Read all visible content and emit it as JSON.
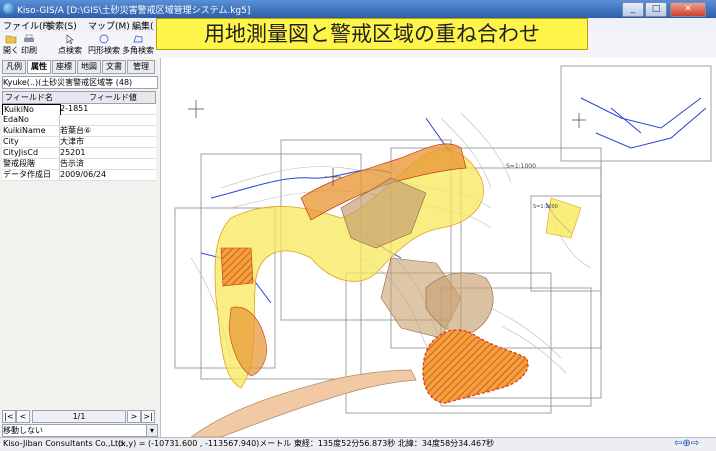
{
  "window": {
    "title": "Kiso-GIS/A [D:\\GIS\\土砂災害警戒区域管理システム.kg5]",
    "minimize": "_",
    "maximize": "□",
    "close": "✕"
  },
  "menu": [
    "ファイル(F)",
    "検索(S)",
    "マップ(M)",
    "編集("
  ],
  "toolbar": {
    "tools": [
      "開く",
      "印刷",
      "点検索",
      "円形検索",
      "多角検索"
    ]
  },
  "banner": {
    "text": "用地測量図と警戒区域の重ね合わせ"
  },
  "left_panel": {
    "tabs": [
      "凡例",
      "属性",
      "座標",
      "地図",
      "文書",
      "管理"
    ],
    "active_tab": "属性",
    "layer": "Kyuke(..)(土砂災害警戒区域等 (48)",
    "columns": {
      "field": "フィールド名",
      "value": "フィールド値"
    },
    "rows": [
      {
        "field": "KuikiNo",
        "value": "2-1851"
      },
      {
        "field": "EdaNo",
        "value": ""
      },
      {
        "field": "KuikiName",
        "value": "若葉台⑥"
      },
      {
        "field": "City",
        "value": "大津市"
      },
      {
        "field": "CityJisCd",
        "value": "25201"
      },
      {
        "field": "警戒段階",
        "value": "告示済"
      },
      {
        "field": "データ作成日",
        "value": "2009/06/24"
      }
    ],
    "pager": {
      "first": "|<",
      "prev": "<",
      "info": "1/1",
      "next": ">",
      "last": ">|"
    },
    "move_mode": "移動しない"
  },
  "map": {
    "scale_labels": [
      "S=1:1000",
      "S=1:1000"
    ],
    "colors": {
      "zone_yellow": "#f7e85a",
      "zone_orange": "#e89a3a",
      "zone_brown": "#c8a070",
      "hatched_red": "#e23a1a",
      "survey_line": "#2a44d6"
    }
  },
  "status": {
    "company": "Kiso-Jiban Consultants Co.,Ltd.",
    "coords": "(x,y) = (-10731.600 , -113567.940)メートル  東経：135度52分56.873秒  北緯：34度58分34.467秒",
    "icons": "⇦⊕⇨"
  }
}
